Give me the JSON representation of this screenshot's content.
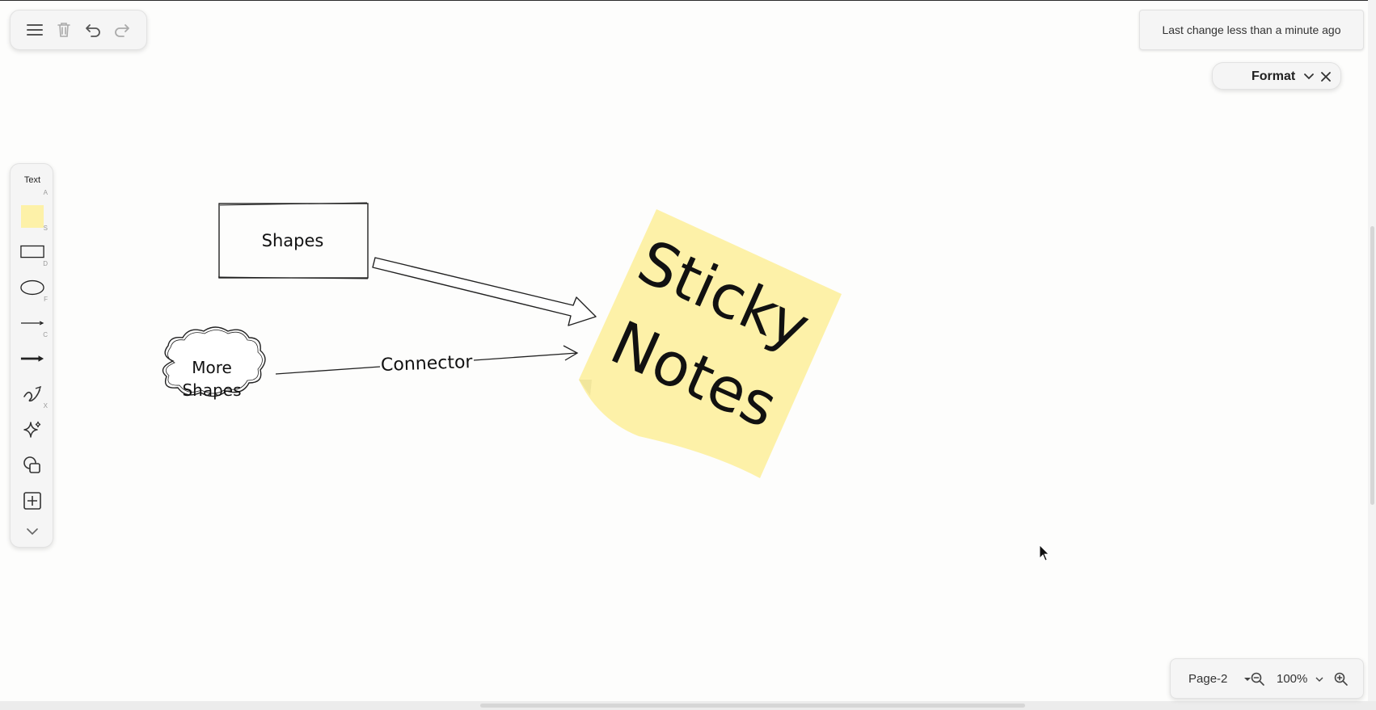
{
  "status": {
    "text": "Last change less than a minute ago"
  },
  "format_panel": {
    "label": "Format"
  },
  "toolbar_left": {
    "text_label": "Text",
    "shortcuts": {
      "text": "A",
      "sticky": "S",
      "rectangle": "D",
      "ellipse": "F",
      "line": "C",
      "freehand": "X"
    }
  },
  "canvas": {
    "shape_rect_label": "Shapes",
    "cloud_line1": "More",
    "cloud_line2": "Shapes",
    "connector_label": "Connector",
    "sticky_line1": "Sticky",
    "sticky_line2": "Notes"
  },
  "page_bar": {
    "page": "Page-2",
    "zoom": "100%"
  },
  "colors": {
    "sticky": "#fdf1a8",
    "panel": "#f5f5f5",
    "accent_text": "#222222"
  },
  "icons": [
    "menu-icon",
    "trash-icon",
    "undo-icon",
    "redo-icon",
    "chevron-down-icon",
    "close-icon",
    "sticky-note-icon",
    "rectangle-icon",
    "ellipse-icon",
    "line-icon",
    "arrow-icon",
    "freehand-icon",
    "sparkle-icon",
    "shapes-icon",
    "insert-plus-icon",
    "expand-chevron-icon",
    "zoom-out-icon",
    "zoom-in-icon",
    "cursor-icon"
  ]
}
